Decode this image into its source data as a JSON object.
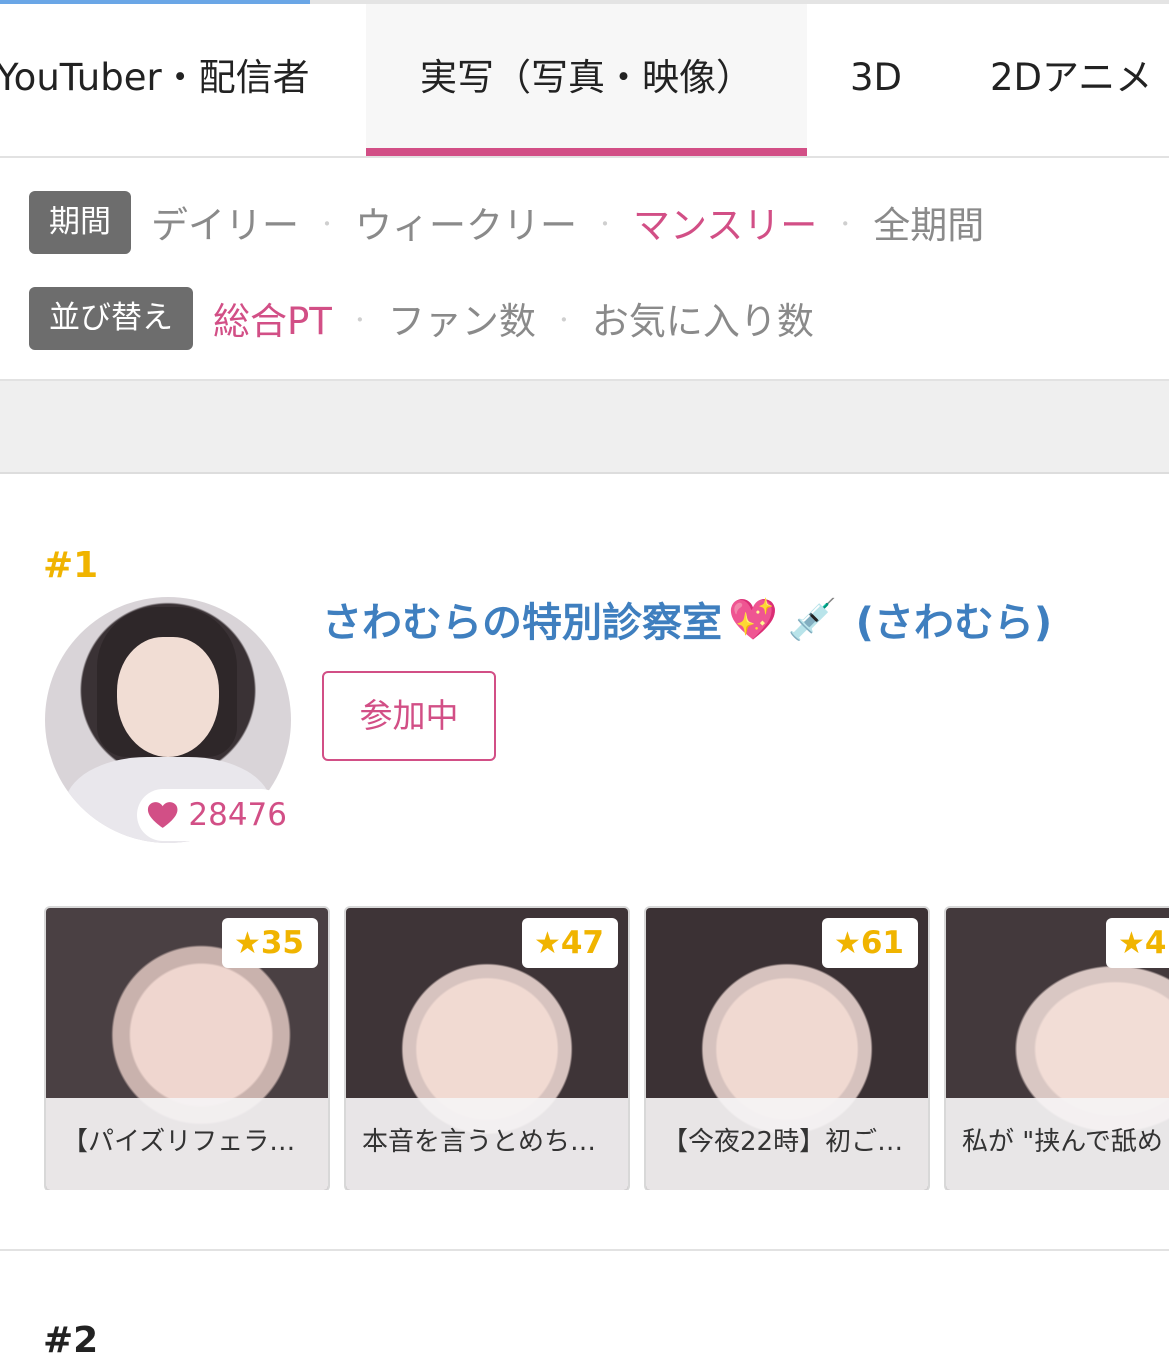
{
  "category_tabs": [
    {
      "label": "YouTuber・配信者",
      "active": false
    },
    {
      "label": "実写（写真・映像）",
      "active": true
    },
    {
      "label": "3D",
      "active": false
    },
    {
      "label": "2Dアニメ",
      "active": false
    }
  ],
  "period": {
    "label": "期間",
    "options": [
      "デイリー",
      "ウィークリー",
      "マンスリー",
      "全期間"
    ],
    "selected": "マンスリー",
    "separator": "・"
  },
  "sort": {
    "label": "並び替え",
    "options": [
      "総合PT",
      "ファン数",
      "お気に入り数"
    ],
    "selected": "総合PT",
    "separator": "・"
  },
  "colors": {
    "accent": "#d24f86",
    "rank_gold": "#f0b400",
    "link_blue": "#3f7fbf",
    "pill_gray": "#6d6d6d"
  },
  "rankings": [
    {
      "rank": "#1",
      "channel_name": "さわむらの特別診察室",
      "channel_emoji_1": "💖",
      "channel_emoji_2": "💉",
      "handle": "(さわむら)",
      "status_button": "参加中",
      "likes": "28476",
      "likes_icon": "heart-icon",
      "videos": [
        {
          "stars": "35",
          "title": "【パイズリフェラ…"
        },
        {
          "stars": "47",
          "title": "本音を言うとめち…"
        },
        {
          "stars": "61",
          "title": "【今夜22時】初ご…"
        },
        {
          "stars": "4",
          "title": "私が \"挟んで舐め"
        }
      ]
    },
    {
      "rank": "#2"
    }
  ]
}
